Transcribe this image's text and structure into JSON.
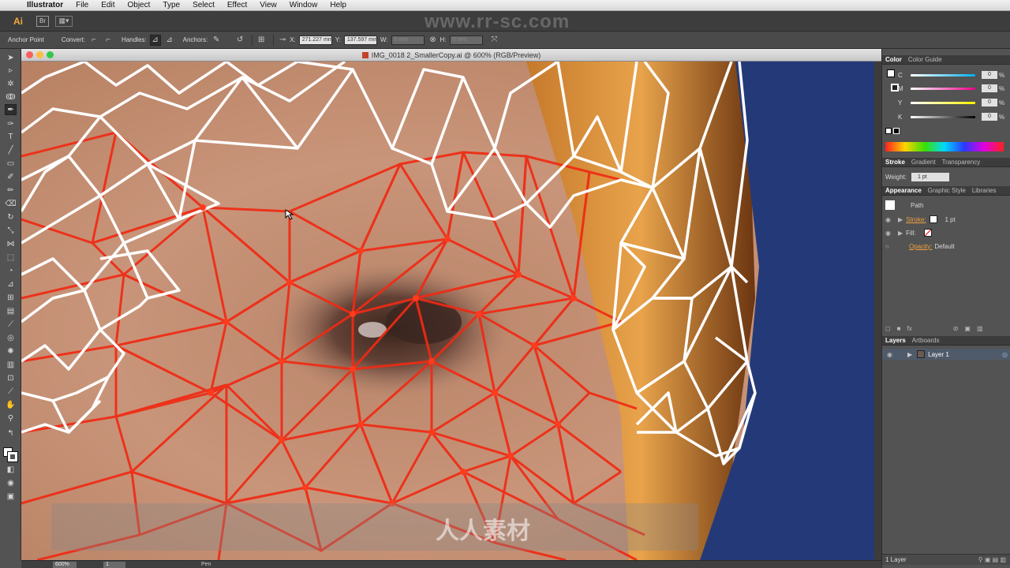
{
  "menubar": {
    "app": "Illustrator",
    "items": [
      "File",
      "Edit",
      "Object",
      "Type",
      "Select",
      "Effect",
      "View",
      "Window",
      "Help"
    ]
  },
  "appbar": {
    "logo": "Ai",
    "bridge": "Br",
    "watermark": "www.rr-sc.com"
  },
  "controlbar": {
    "anchor_point": "Anchor Point",
    "convert": "Convert:",
    "handles": "Handles:",
    "anchors": "Anchors:",
    "x_label": "X:",
    "x_value": "271.227 mm",
    "y_label": "Y:",
    "y_value": "137.597 mm",
    "w_label": "W:",
    "w_value": "0 mm",
    "h_label": "H:",
    "h_value": "0 mm"
  },
  "document": {
    "title": "IMG_0018 2_SmallerCopy.ai @ 600% (RGB/Preview)",
    "center_watermark": "人人素材"
  },
  "statusbar": {
    "zoom": "600%",
    "page": "1",
    "tool": "Pen"
  },
  "panels": {
    "color_tabs": [
      "Color",
      "Color Guide"
    ],
    "channels": [
      {
        "name": "C",
        "value": "0",
        "color": "#00aeef"
      },
      {
        "name": "M",
        "value": "0",
        "color": "#ec008c"
      },
      {
        "name": "Y",
        "value": "0",
        "color": "#fff200"
      },
      {
        "name": "K",
        "value": "0",
        "color": "#000000"
      }
    ],
    "pct": "%",
    "stroke_tabs": [
      "Stroke",
      "Gradient",
      "Transparency"
    ],
    "weight_label": "Weight:",
    "weight_value": "1 pt",
    "appearance_tabs": [
      "Appearance",
      "Graphic Style",
      "Libraries"
    ],
    "path_label": "Path",
    "stroke_label": "Stroke:",
    "stroke_value": "1 pt",
    "fill_label": "Fill:",
    "opacity_label": "Opacity:",
    "opacity_value": "Default",
    "layers_tabs": [
      "Layers",
      "Artboards"
    ],
    "layer_name": "Layer 1",
    "layer_count": "1 Layer"
  }
}
